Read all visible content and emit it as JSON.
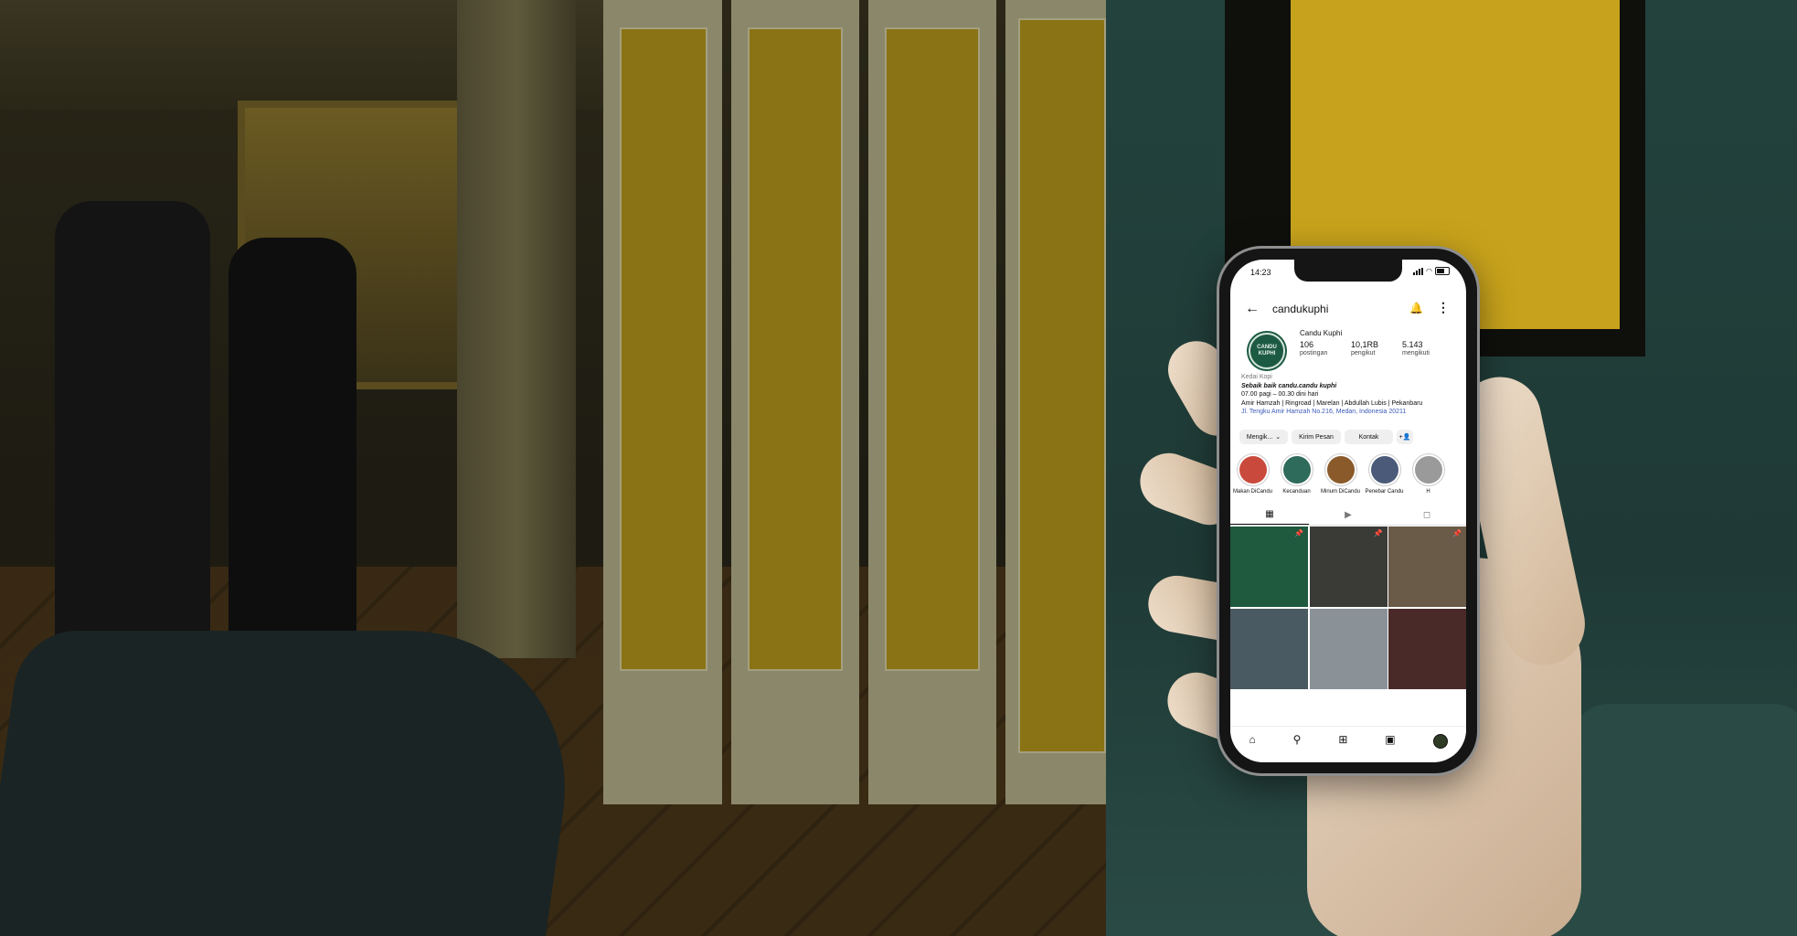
{
  "status": {
    "time": "14:23"
  },
  "profile": {
    "handle": "candukuphi",
    "display_name": "Candu Kuphi",
    "avatar_text": "CANDU KUPHI",
    "stats": [
      {
        "value": "106",
        "label": "postingan"
      },
      {
        "value": "10,1RB",
        "label": "pengikut"
      },
      {
        "value": "5.143",
        "label": "mengikuti"
      }
    ],
    "category": "Kedai Kopi",
    "tagline": "Sebaik baik candu.candu kuphi",
    "hours": "07.00 pagi – 00.30 dini hari",
    "locations": "Amir Hamzah | Ringroad | Marelan | Abdullah Lubis | Pekanbaru",
    "address": "Jl. Tengku Amir Hamzah No.216, Medan, Indonesia 20211"
  },
  "actions": {
    "following": "Mengik...",
    "message": "Kirim Pesan",
    "contact": "Kontak"
  },
  "highlights": [
    {
      "label": "Makan DiCandu",
      "color": "#c94a3c"
    },
    {
      "label": "Kecanduan",
      "color": "#2f6b5a"
    },
    {
      "label": "Minum DiCandu",
      "color": "#8a5a2a"
    },
    {
      "label": "Penebar Candu",
      "color": "#4a5a78"
    },
    {
      "label": "H",
      "color": "#9a9a9a"
    }
  ],
  "tabs": [
    "grid-icon",
    "reels-icon",
    "tagged-icon"
  ],
  "posts": [
    {
      "color": "#1f5a3e",
      "pinned": true
    },
    {
      "color": "#3a3a36",
      "pinned": true
    },
    {
      "color": "#6a5a48",
      "pinned": true
    },
    {
      "color": "#4a5a62",
      "pinned": false
    },
    {
      "color": "#8a9298",
      "pinned": false
    },
    {
      "color": "#4a2a28",
      "pinned": false
    }
  ],
  "accent": {
    "link": "#3b5ab8",
    "brand_green": "#1d5a44"
  }
}
